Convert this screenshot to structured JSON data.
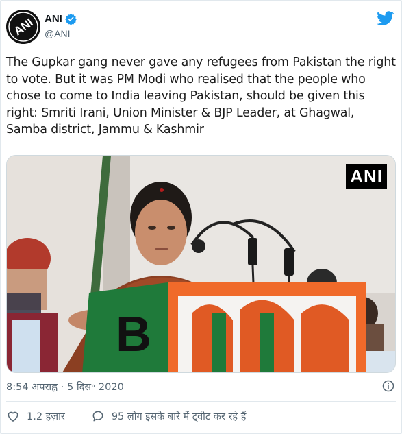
{
  "account": {
    "display_name": "ANI",
    "handle": "@ANI",
    "avatar_text": "ANI",
    "verified": true
  },
  "tweet": {
    "text": "The Gupkar gang never gave any refugees from Pakistan the right to vote. But it was PM Modi who realised that the people who chose to come to India leaving Pakistan, should be given this right: Smriti Irani, Union Minister & BJP Leader, at Ghagwal, Samba district, Jammu & Kashmir",
    "timestamp": "8:54 अपराह्न · 5 दिस॰ 2020"
  },
  "media": {
    "watermark": "ANI",
    "podium_letter": "B"
  },
  "actions": {
    "likes": "1.2 हज़ार",
    "replies_text": "95 लोग इसके बारे में ट्वीट कर रहे हैं"
  },
  "icons": [
    "verified-badge-icon",
    "twitter-bird-icon",
    "info-icon",
    "heart-icon",
    "speech-bubble-icon"
  ],
  "colors": {
    "twitter_blue": "#1d9bf0",
    "secondary_text": "#536471"
  }
}
